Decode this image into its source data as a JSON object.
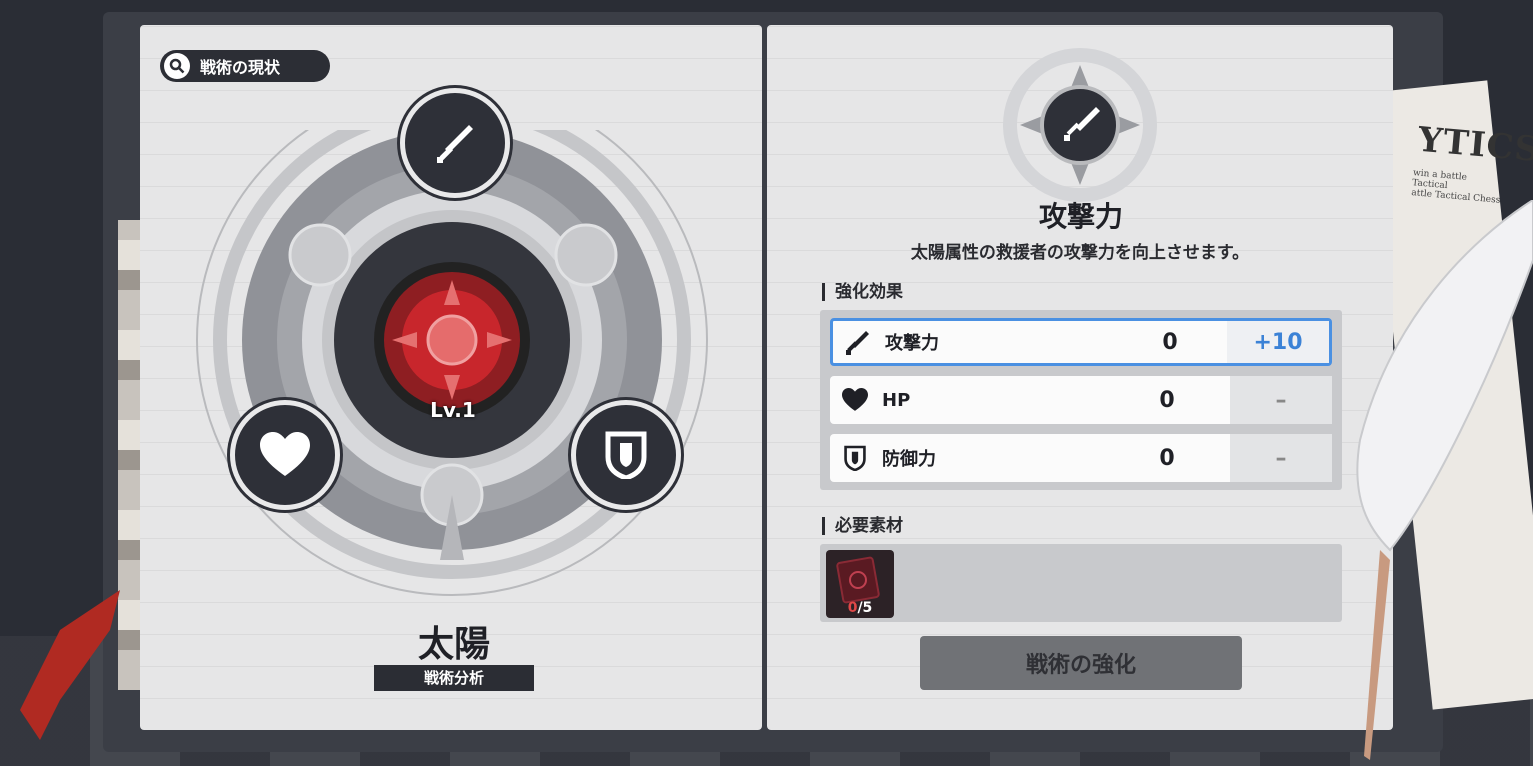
{
  "left": {
    "status_button": "戦術の現状",
    "level": "Lv.1",
    "title": "太陽",
    "subtitle": "戦術分析"
  },
  "right": {
    "title": "攻撃力",
    "description": "太陽属性の救援者の攻撃力を向上させます。",
    "effects_header": "強化効果",
    "effects": [
      {
        "icon": "sword-icon",
        "label": "攻撃力",
        "value": "0",
        "bonus": "+10",
        "selected": true
      },
      {
        "icon": "heart-icon",
        "label": "HP",
        "value": "0",
        "bonus": "–",
        "selected": false
      },
      {
        "icon": "shield-icon",
        "label": "防御力",
        "value": "0",
        "bonus": "–",
        "selected": false
      }
    ],
    "materials_header": "必要素材",
    "material": {
      "have": "0",
      "need": "/5"
    },
    "enhance_button": "戦術の強化"
  },
  "newspaper": {
    "headline": "YTICS",
    "lines": [
      "win a battle Tactical",
      "attle Tactical Chess"
    ]
  },
  "colors": {
    "accent_blue": "#3b82d6",
    "red_core": "#c8262c",
    "dark": "#2e3038"
  }
}
